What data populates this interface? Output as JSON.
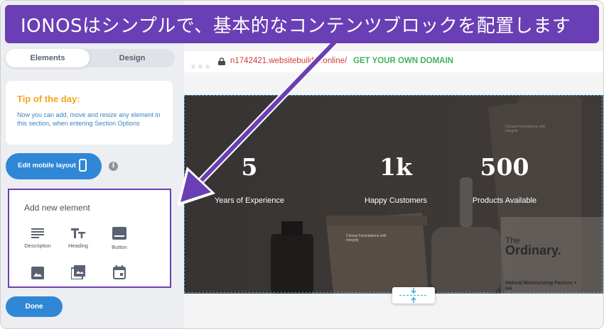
{
  "banner": {
    "text": "IONOSはシンプルで、基本的なコンテンツブロックを配置します"
  },
  "sidebar": {
    "tabs": [
      {
        "label": "Elements"
      },
      {
        "label": "Design"
      }
    ],
    "tip": {
      "title": "Tip of the day:",
      "text": "Now you can add, move and resize any element in this section, when entering Section Options"
    },
    "edit_mobile_label": "Edit mobile layout",
    "add_element": {
      "title": "Add new element",
      "items": [
        {
          "label": "Description",
          "icon": "description-icon"
        },
        {
          "label": "Heading",
          "icon": "heading-icon"
        },
        {
          "label": "Button",
          "icon": "button-icon"
        },
        {
          "label": "",
          "icon": "image-icon"
        },
        {
          "label": "",
          "icon": "gallery-icon"
        },
        {
          "label": "",
          "icon": "calendar-icon"
        }
      ]
    },
    "done_label": "Done"
  },
  "browser": {
    "url": "n1742421.websitebuilder.online/",
    "domain_link": "GET YOUR OWN DOMAIN"
  },
  "hero": {
    "stats": [
      {
        "value": "5",
        "label": "Years of Experience"
      },
      {
        "value": "1k",
        "label": "Happy Customers"
      },
      {
        "value": "500",
        "label": "Products Available"
      }
    ],
    "product_text": {
      "clinical": "Clinical Formulations with Integrity",
      "brand_the": "The",
      "brand_name": "Ordinary.",
      "moisturizing": "Natural Moisturizing Factors + HA"
    }
  },
  "colors": {
    "banner": "#6a3fb5",
    "tip_title": "#f4a31a",
    "tip_text": "#3b82c4",
    "primary_button": "#2f87d6",
    "url_text": "#d23b3b",
    "domain_link": "#45b25a"
  }
}
